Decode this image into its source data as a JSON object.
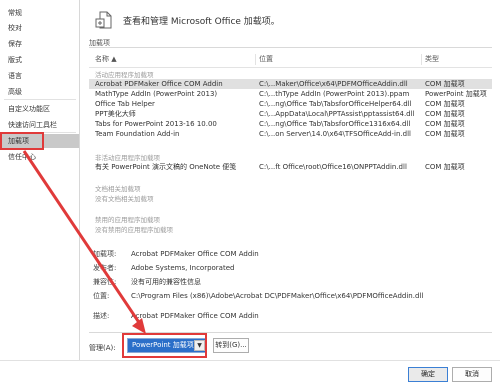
{
  "sidebar": {
    "items": [
      {
        "label": "常规"
      },
      {
        "label": "校对"
      },
      {
        "label": "保存"
      },
      {
        "label": "版式"
      },
      {
        "label": "语言"
      },
      {
        "label": "高级"
      },
      {
        "label": "自定义功能区"
      },
      {
        "label": "快速访问工具栏"
      },
      {
        "label": "加载项"
      },
      {
        "label": "信任中心"
      }
    ],
    "active_index": 8
  },
  "header": {
    "title": "查看和管理 Microsoft Office 加载项。"
  },
  "addins_section": {
    "label": "加载项",
    "columns": [
      "名称 ▲",
      "位置",
      "类型"
    ],
    "groups": [
      {
        "label": "活动应用程序加载项",
        "rows": [
          {
            "name": "Acrobat PDFMaker Office COM Addin",
            "location": "C:\\...Maker\\Office\\x64\\PDFMOfficeAddin.dll",
            "type": "COM 加载项"
          },
          {
            "name": "MathType AddIn (PowerPoint 2013)",
            "location": "C:\\...thType AddIn (PowerPoint 2013).ppam",
            "type": "PowerPoint 加载项"
          },
          {
            "name": "Office Tab Helper",
            "location": "C:\\...ng\\Office Tab\\TabsforOfficeHelper64.dll",
            "type": "COM 加载项"
          },
          {
            "name": "PPT美化大师",
            "location": "C:\\...AppData\\Local\\PPTAssist\\pptassist64.dll",
            "type": "COM 加载项"
          },
          {
            "name": "Tabs for PowerPoint 2013-16 10.00",
            "location": "C:\\...ng\\Office Tab\\TabsforOffice1316x64.dll",
            "type": "COM 加载项"
          },
          {
            "name": "Team Foundation Add-in",
            "location": "C:\\...on Server\\14.0\\x64\\TFSOfficeAdd-in.dll",
            "type": "COM 加载项"
          }
        ]
      },
      {
        "label": "非活动应用程序加载项",
        "rows": [
          {
            "name": "有关 PowerPoint 演示文稿的 OneNote 便笺",
            "location": "C:\\...ft Office\\root\\Office16\\ONPPTAddin.dll",
            "type": "COM 加载项"
          }
        ]
      },
      {
        "label": "文档相关加载项",
        "rows": [
          {
            "name": "没有文档相关加载项",
            "location": "",
            "type": ""
          }
        ]
      },
      {
        "label": "禁用的应用程序加载项",
        "rows": [
          {
            "name": "没有禁用的应用程序加载项",
            "location": "",
            "type": ""
          }
        ]
      }
    ]
  },
  "details": {
    "addin_label": "加载项:",
    "addin_value": "Acrobat PDFMaker Office COM Addin",
    "publisher_label": "发布者:",
    "publisher_value": "Adobe Systems, Incorporated",
    "compat_label": "兼容性:",
    "compat_value": "没有可用的兼容性信息",
    "location_label": "位置:",
    "location_value": "C:\\Program Files (x86)\\Adobe\\Acrobat DC\\PDFMaker\\Office\\x64\\PDFMOfficeAddin.dll",
    "desc_label": "描述:",
    "desc_value": "Acrobat PDFMaker Office COM Addin"
  },
  "manage": {
    "label": "管理(A):",
    "selected": "PowerPoint 加载项",
    "go_label": "转到(G)..."
  },
  "footer": {
    "ok_label": "确定",
    "cancel_label": "取消"
  },
  "colors": {
    "accent": "#2b6fc9",
    "highlight_box": "#e03a3a",
    "selected_sidebar": "#c9c9c9"
  }
}
